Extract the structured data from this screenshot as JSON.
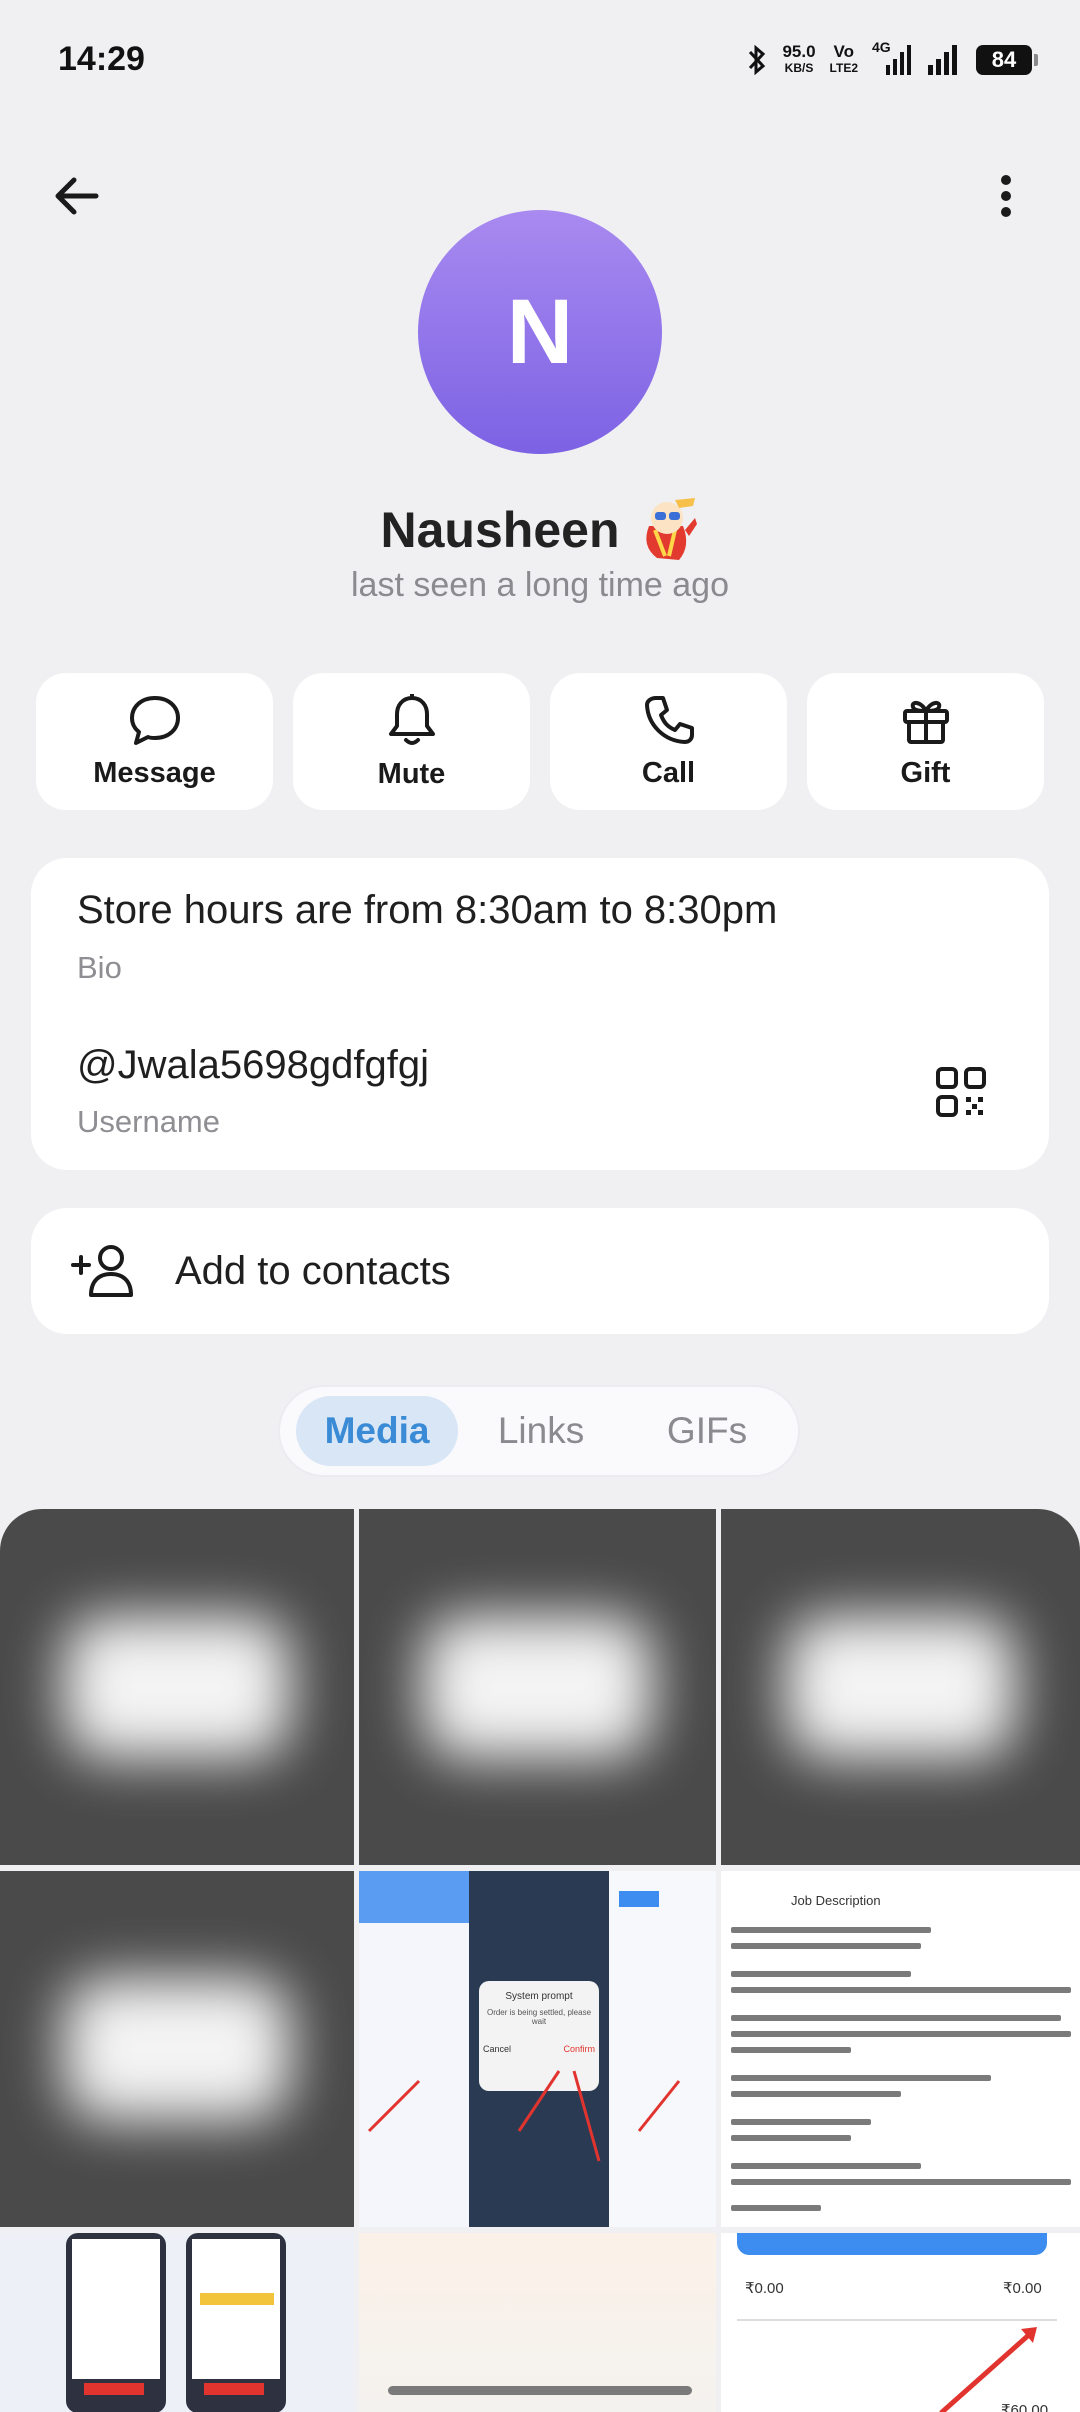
{
  "status_bar": {
    "time": "14:29",
    "net_speed": "95.0",
    "net_unit": "KB/S",
    "volte_top": "Vo",
    "volte_bottom": "LTE2",
    "network_type": "4G",
    "battery": "84",
    "icons": [
      "bluetooth-icon",
      "signal-icon",
      "signal-icon",
      "battery-icon"
    ]
  },
  "header": {
    "back_icon": "arrow-left-icon",
    "menu_icon": "more-vertical-icon"
  },
  "profile": {
    "avatar_letter": "N",
    "avatar_colors": [
      "#a98af0",
      "#7c62e4"
    ],
    "name": "Nausheen",
    "status": "last seen a long time ago"
  },
  "actions": [
    {
      "label": "Message",
      "icon": "chat-bubble-icon"
    },
    {
      "label": "Mute",
      "icon": "bell-icon"
    },
    {
      "label": "Call",
      "icon": "phone-icon"
    },
    {
      "label": "Gift",
      "icon": "gift-icon"
    }
  ],
  "info": {
    "bio": "Store hours are from 8:30am to 8:30pm",
    "bio_label": "Bio",
    "username": "@Jwala5698gdfgfgj",
    "username_label": "Username",
    "qr_icon": "qr-code-icon"
  },
  "add_contact": {
    "label": "Add to contacts",
    "icon": "add-person-icon"
  },
  "tabs": [
    {
      "label": "Media",
      "active": true
    },
    {
      "label": "Links",
      "active": false
    },
    {
      "label": "GIFs",
      "active": false
    }
  ],
  "media_thumbs": {
    "c5": {
      "dialog_title": "System prompt",
      "dialog_body": "Order is being settled, please wait",
      "cancel": "Cancel",
      "confirm": "Confirm"
    },
    "c6": {
      "title": "Job Description"
    },
    "c9": {
      "amount1": "₹0.00",
      "amount2": "₹0.00",
      "amount3": "₹60.00"
    }
  },
  "colors": {
    "accent": "#3a8ad5",
    "background": "#f0f0f3",
    "card": "#ffffff"
  }
}
